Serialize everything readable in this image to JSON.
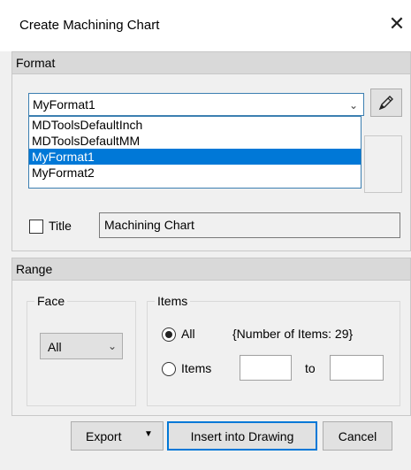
{
  "window": {
    "title": "Create Machining Chart",
    "close_symbol": "✕"
  },
  "format": {
    "group_label": "Format",
    "selected": "MyFormat1",
    "options": [
      "MDToolsDefaultInch",
      "MDToolsDefaultMM",
      "MyFormat1",
      "MyFormat2"
    ],
    "selected_index": 2,
    "edit_icon": "pencil-icon",
    "title_check_label": "Title",
    "title_checked": false,
    "title_value": "Machining Chart"
  },
  "range": {
    "group_label": "Range",
    "face": {
      "legend": "Face",
      "selected": "All"
    },
    "items": {
      "legend": "Items",
      "all_label": "All",
      "count_text": "{Number of Items: 29}",
      "items_label": "Items",
      "to_label": "to",
      "from_value": "",
      "to_value": "",
      "selected": "All"
    }
  },
  "buttons": {
    "export": "Export",
    "insert": "Insert into Drawing",
    "cancel": "Cancel"
  },
  "colors": {
    "accent": "#0078d7",
    "header": "#d9d9d9",
    "background": "#f0f0f0"
  }
}
